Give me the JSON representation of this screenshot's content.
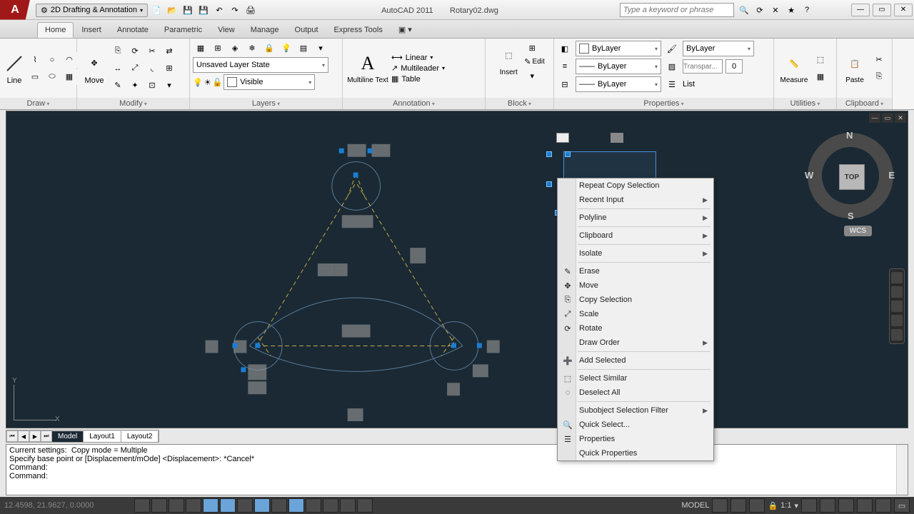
{
  "app": {
    "name": "AutoCAD 2011",
    "document": "Rotary02.dwg"
  },
  "qat": {
    "workspace": "2D Drafting & Annotation"
  },
  "search": {
    "placeholder": "Type a keyword or phrase"
  },
  "tabs": [
    "Home",
    "Insert",
    "Annotate",
    "Parametric",
    "View",
    "Manage",
    "Output",
    "Express Tools"
  ],
  "active_tab": "Home",
  "ribbon": {
    "draw": {
      "title": "Draw",
      "line": "Line"
    },
    "modify": {
      "title": "Modify",
      "move": "Move"
    },
    "layers": {
      "title": "Layers",
      "state": "Unsaved Layer State",
      "visible": "Visible"
    },
    "annotation": {
      "title": "Annotation",
      "mtext": "Multiline Text",
      "linear": "Linear",
      "multileader": "Multileader",
      "table": "Table"
    },
    "block": {
      "title": "Block",
      "insert": "Insert",
      "edit": "Edit"
    },
    "properties": {
      "title": "Properties",
      "bylayer": "ByLayer",
      "bylayer2": "ByLayer",
      "bylayer3": "ByLayer",
      "transparency_ph": "Transpar...",
      "transparency_val": "0",
      "bylayer_combo": "ByLayer",
      "list": "List"
    },
    "utilities": {
      "title": "Utilities",
      "measure": "Measure"
    },
    "clipboard": {
      "title": "Clipboard",
      "paste": "Paste"
    }
  },
  "context_menu": {
    "items": [
      {
        "label": "Repeat Copy Selection"
      },
      {
        "label": "Recent Input",
        "sub": true
      },
      {
        "sep": true
      },
      {
        "label": "Polyline",
        "sub": true
      },
      {
        "sep": true
      },
      {
        "label": "Clipboard",
        "sub": true
      },
      {
        "sep": true
      },
      {
        "label": "Isolate",
        "sub": true
      },
      {
        "sep": true
      },
      {
        "label": "Erase",
        "icon": "erase"
      },
      {
        "label": "Move",
        "icon": "move"
      },
      {
        "label": "Copy Selection",
        "icon": "copy"
      },
      {
        "label": "Scale",
        "icon": "scale"
      },
      {
        "label": "Rotate",
        "icon": "rotate"
      },
      {
        "label": "Draw Order",
        "sub": true
      },
      {
        "sep": true
      },
      {
        "label": "Add Selected",
        "icon": "add"
      },
      {
        "sep": true
      },
      {
        "label": "Select Similar",
        "icon": "selsim"
      },
      {
        "label": "Deselect All",
        "icon": "desel"
      },
      {
        "sep": true
      },
      {
        "label": "Subobject Selection Filter",
        "sub": true
      },
      {
        "label": "Quick Select...",
        "icon": "qsel"
      },
      {
        "label": "Properties",
        "icon": "props"
      },
      {
        "label": "Quick Properties"
      }
    ]
  },
  "sheets": [
    "Model",
    "Layout1",
    "Layout2"
  ],
  "cmdline": [
    "Current settings:  Copy mode = Multiple",
    "Specify base point or [Displacement/mOde] <Displacement>: *Cancel*",
    "Command:",
    "Command:"
  ],
  "status": {
    "coords": "12.4598, 21.9627, 0.0000",
    "model": "MODEL",
    "scale": "1:1"
  },
  "viewcube": {
    "top": "TOP",
    "n": "N",
    "s": "S",
    "e": "E",
    "w": "W",
    "wcs": "WCS"
  },
  "ucs": {
    "x": "X",
    "y": "Y"
  }
}
